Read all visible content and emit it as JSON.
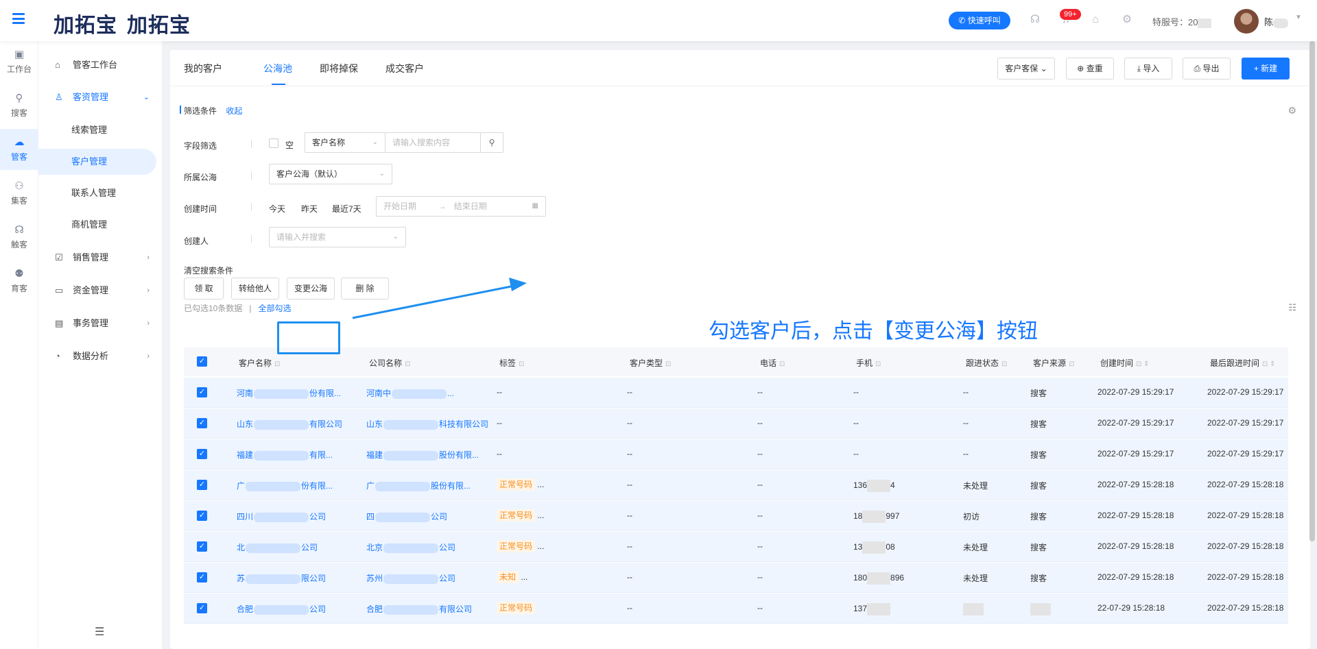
{
  "header": {
    "logo_text_1": "加拓宝",
    "logo_text_2": "加拓宝",
    "quick_call": "快速呼叫",
    "notification_count": "99+",
    "service_no_label": "特服号：20",
    "username": "陈"
  },
  "rail": [
    {
      "label": "工作台",
      "icon": "monitor-icon"
    },
    {
      "label": "搜客",
      "icon": "search-user-icon"
    },
    {
      "label": "管客",
      "icon": "cloud-crm-icon"
    },
    {
      "label": "集客",
      "icon": "group-icon"
    },
    {
      "label": "触客",
      "icon": "headset-icon"
    },
    {
      "label": "育客",
      "icon": "people-icon"
    }
  ],
  "sidebar": {
    "items": [
      {
        "label": "管客工作台"
      },
      {
        "label": "客资管理"
      },
      {
        "label": "销售管理"
      },
      {
        "label": "资金管理"
      },
      {
        "label": "事务管理"
      },
      {
        "label": "数据分析"
      }
    ],
    "sub": [
      {
        "label": "线索管理"
      },
      {
        "label": "客户管理"
      },
      {
        "label": "联系人管理"
      },
      {
        "label": "商机管理"
      }
    ]
  },
  "tabs": [
    "我的客户",
    "公海池",
    "即将掉保",
    "成交客户"
  ],
  "toolbar": {
    "guard": "客户客保",
    "dedupe": "查重",
    "import": "导入",
    "export": "导出",
    "create": "+ 新建"
  },
  "filter": {
    "title": "筛选条件",
    "collapse": "收起",
    "field_label": "字段筛选",
    "empty_label": "空",
    "field_select": "客户名称",
    "search_placeholder": "请输入搜索内容",
    "pool_label": "所属公海",
    "pool_value": "客户公海（默认）",
    "created_label": "创建时间",
    "today": "今天",
    "yesterday": "昨天",
    "last7": "最近7天",
    "start_placeholder": "开始日期",
    "end_placeholder": "结束日期",
    "creator_label": "创建人",
    "creator_placeholder": "请输入并搜索",
    "clear": "清空搜索条件"
  },
  "annotation": "勾选客户后，点击【变更公海】按钮",
  "selection": {
    "info": "已勾选10条数据",
    "select_all": "全部勾选"
  },
  "actions": {
    "claim": "领 取",
    "transfer": "转给他人",
    "change_pool": "变更公海",
    "delete": "删 除"
  },
  "table": {
    "headers": [
      "客户名称",
      "公司名称",
      "标签",
      "客户类型",
      "电话",
      "手机",
      "跟进状态",
      "客户来源",
      "创建时间",
      "最后跟进时间"
    ],
    "rows": [
      {
        "name_a": "河南",
        "name_b": "份有限...",
        "company_a": "河南中",
        "company_b": "...",
        "tag": "--",
        "tag_more": "",
        "type": "--",
        "phone": "--",
        "mobile_a": "--",
        "mobile_b": "",
        "status": "--",
        "source": "搜客",
        "created": "2022-07-29 15:29:17",
        "last": "2022-07-29 15:29:17"
      },
      {
        "name_a": "山东",
        "name_b": "有限公司",
        "company_a": "山东",
        "company_b": "科技有限公司",
        "tag": "--",
        "tag_more": "",
        "type": "--",
        "phone": "--",
        "mobile_a": "--",
        "mobile_b": "",
        "status": "--",
        "source": "搜客",
        "created": "2022-07-29 15:29:17",
        "last": "2022-07-29 15:29:17"
      },
      {
        "name_a": "福建",
        "name_b": "有限...",
        "company_a": "福建",
        "company_b": "股份有限...",
        "tag": "--",
        "tag_more": "",
        "type": "--",
        "phone": "--",
        "mobile_a": "--",
        "mobile_b": "",
        "status": "--",
        "source": "搜客",
        "created": "2022-07-29 15:29:17",
        "last": "2022-07-29 15:29:17"
      },
      {
        "name_a": "广",
        "name_b": "份有限...",
        "company_a": "广",
        "company_b": "股份有限...",
        "tag": "正常号码",
        "tag_more": "...",
        "type": "--",
        "phone": "--",
        "mobile_a": "136",
        "mobile_b": "4",
        "status": "未处理",
        "source": "搜客",
        "created": "2022-07-29 15:28:18",
        "last": "2022-07-29 15:28:18"
      },
      {
        "name_a": "四川",
        "name_b": "公司",
        "company_a": "四",
        "company_b": "公司",
        "tag": "正常号码",
        "tag_more": "...",
        "type": "--",
        "phone": "--",
        "mobile_a": "18",
        "mobile_b": "997",
        "status": "初访",
        "source": "搜客",
        "created": "2022-07-29 15:28:18",
        "last": "2022-07-29 15:28:18"
      },
      {
        "name_a": "北",
        "name_b": "公司",
        "company_a": "北京",
        "company_b": "公司",
        "tag": "正常号码",
        "tag_more": "...",
        "type": "--",
        "phone": "--",
        "mobile_a": "13",
        "mobile_b": "08",
        "status": "未处理",
        "source": "搜客",
        "created": "2022-07-29 15:28:18",
        "last": "2022-07-29 15:28:18"
      },
      {
        "name_a": "苏",
        "name_b": "限公司",
        "company_a": "苏州",
        "company_b": "公司",
        "tag": "未知",
        "tag_more": "...",
        "type": "--",
        "phone": "--",
        "mobile_a": "180",
        "mobile_b": "896",
        "status": "未处理",
        "source": "搜客",
        "created": "2022-07-29 15:28:18",
        "last": "2022-07-29 15:28:18"
      },
      {
        "name_a": "合肥",
        "name_b": "公司",
        "company_a": "合肥",
        "company_b": "有限公司",
        "tag": "正常号码",
        "tag_more": "",
        "type": "--",
        "phone": "--",
        "mobile_a": "137",
        "mobile_b": "",
        "status": "",
        "source": "",
        "created": "22-07-29 15:28:18",
        "last": "2022-07-29 15:28:18"
      }
    ]
  }
}
